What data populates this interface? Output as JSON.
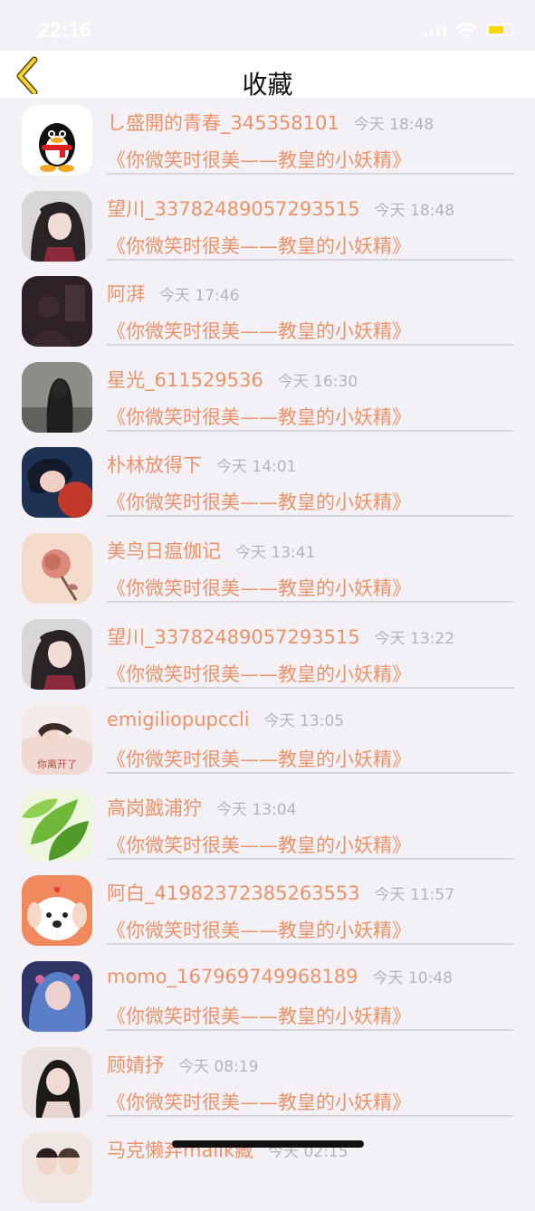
{
  "status_bar": {
    "time": "22:16"
  },
  "nav": {
    "title": "收藏"
  },
  "colors": {
    "accent": "#e8936a",
    "timestamp": "#b7b3b9",
    "background": "#f4f1f6"
  },
  "items": [
    {
      "name": "し盛開的青春_345358101",
      "time": "今天 18:48",
      "content": "《你微笑时很美——教皇的小妖精》",
      "avatar": "qq-penguin-avatar"
    },
    {
      "name": "望川_33782489057293515",
      "time": "今天 18:48",
      "content": "《你微笑时很美——教皇的小妖精》",
      "avatar": "anime-girl-avatar"
    },
    {
      "name": "阿湃",
      "time": "今天 17:46",
      "content": "《你微笑时很美——教皇的小妖精》",
      "avatar": "dark-photo-avatar"
    },
    {
      "name": "星光_611529536",
      "time": "今天 16:30",
      "content": "《你微笑时很美——教皇的小妖精》",
      "avatar": "girl-photo-avatar"
    },
    {
      "name": "朴林放得下",
      "time": "今天 14:01",
      "content": "《你微笑时很美——教皇的小妖精》",
      "avatar": "illustration-avatar"
    },
    {
      "name": "美鸟日瘟伽记",
      "time": "今天 13:41",
      "content": "《你微笑时很美——教皇的小妖精》",
      "avatar": "rose-avatar"
    },
    {
      "name": "望川_33782489057293515",
      "time": "今天 13:22",
      "content": "《你微笑时很美——教皇的小妖精》",
      "avatar": "anime-girl-avatar"
    },
    {
      "name": "emigiliopupccli",
      "time": "今天 13:05",
      "content": "《你微笑时很美——教皇的小妖精》",
      "avatar": "sleeping-girl-avatar",
      "avatar_caption": "你离开了"
    },
    {
      "name": "高岗戤浦狞",
      "time": "今天 13:04",
      "content": "《你微笑时很美——教皇的小妖精》",
      "avatar": "leaves-avatar"
    },
    {
      "name": "阿白_41982372385263553",
      "time": "今天 11:57",
      "content": "《你微笑时很美——教皇的小妖精》",
      "avatar": "cartoon-dog-avatar"
    },
    {
      "name": "momo_167969749968189",
      "time": "今天 10:48",
      "content": "《你微笑时很美——教皇的小妖精》",
      "avatar": "blue-hair-girl-avatar"
    },
    {
      "name": "顾婧抒",
      "time": "今天 08:19",
      "content": "《你微笑时很美——教皇的小妖精》",
      "avatar": "portrait-avatar"
    },
    {
      "name": "马克懒弃malik藏",
      "time": "今天 02:15",
      "content": "",
      "avatar": "couple-avatar"
    }
  ]
}
